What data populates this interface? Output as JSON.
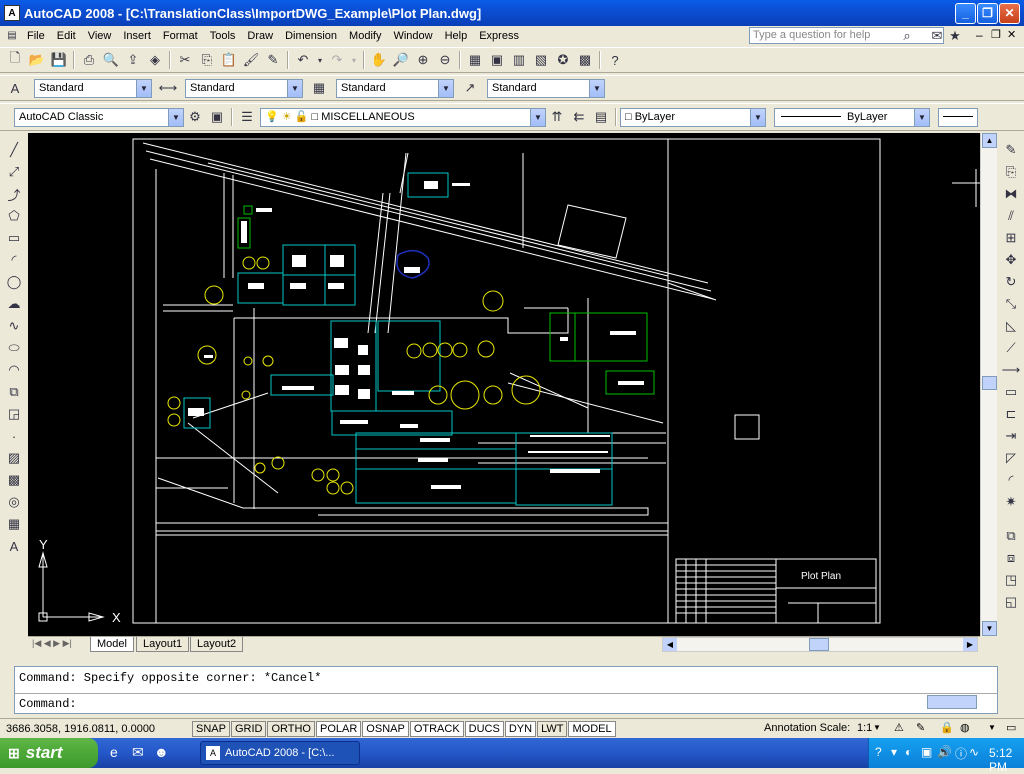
{
  "window": {
    "title": "AutoCAD 2008 - [C:\\TranslationClass\\ImportDWG_Example\\Plot Plan.dwg]",
    "app_icon": "autocad-icon",
    "minimize": "_",
    "restore": "❐",
    "close": "✕",
    "doc_minimize": "–",
    "doc_restore": "❐",
    "doc_close": "✕"
  },
  "menu": {
    "items": [
      "File",
      "Edit",
      "View",
      "Insert",
      "Format",
      "Tools",
      "Draw",
      "Dimension",
      "Modify",
      "Window",
      "Help",
      "Express"
    ],
    "help_placeholder": "Type a question for help"
  },
  "styles_toolbar": {
    "text_style": "Standard",
    "dim_style": "Standard",
    "table_style": "Standard",
    "mleader_style": "Standard"
  },
  "layers_toolbar": {
    "workspace": "AutoCAD Classic",
    "current_layer": "MISCELLANEOUS",
    "color": "ByLayer",
    "linetype": "ByLayer"
  },
  "drawing": {
    "title_block_text": "Plot Plan",
    "ucs_x": "X",
    "ucs_y": "Y",
    "colors": {
      "background": "#000000",
      "white": "#ffffff",
      "cyan": "#00c8c8",
      "yellow": "#e8e800",
      "green": "#00c000",
      "blue": "#2030c0"
    }
  },
  "layout_tabs": [
    "Model",
    "Layout1",
    "Layout2"
  ],
  "command": {
    "history": "Command: Specify opposite corner: *Cancel*",
    "prompt": "Command:"
  },
  "status": {
    "coords": "3686.3058, 1916.0811, 0.0000",
    "toggles": [
      "SNAP",
      "GRID",
      "ORTHO",
      "POLAR",
      "OSNAP",
      "OTRACK",
      "DUCS",
      "DYN",
      "LWT",
      "MODEL"
    ],
    "annotation_scale_label": "Annotation Scale:",
    "annotation_scale_value": "1:1"
  },
  "taskbar": {
    "start": "start",
    "task": "AutoCAD 2008 - [C:\\...",
    "clock": "5:12 PM"
  }
}
